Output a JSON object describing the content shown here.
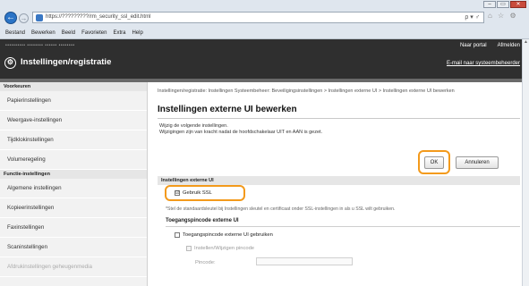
{
  "browser": {
    "window_buttons": [
      "–",
      "▭",
      "✕"
    ],
    "address_url": "https://?????????/rm_security_ssl_edit.html",
    "address_icons": "ρ ▾ ♂",
    "tab_stub": "⌂ ☆ ⚙",
    "menu": [
      "Bestand",
      "Bewerken",
      "Beeld",
      "Favorieten",
      "Extra",
      "Help"
    ]
  },
  "header": {
    "device_info": "••••••••••  ••••••••  ••••••  ••••••••",
    "title": "Instellingen/registratie",
    "links": [
      "Naar portal",
      "Afmelden"
    ],
    "email_link": "E-mail naar systeembeheerder"
  },
  "sidebar": {
    "sections": [
      {
        "title": "Voorkeuren",
        "items": [
          "Papierinstellingen",
          "Weergave-instellingen",
          "Tijdklokinstellingen",
          "Volumeregeling"
        ]
      },
      {
        "title": "Functie-instellingen",
        "items": [
          "Algemene instellingen",
          "Kopieerinstellingen",
          "Faxinstellingen",
          "Scaninstellingen",
          "Afdrukinstellingen geheugenmedia"
        ]
      }
    ]
  },
  "main": {
    "breadcrumb": "Instellingen/registratie: Instellingen Systeembeheer: Beveiligingsinstellingen > Instellingen externe UI > Instellingen externe UI bewerken",
    "title": "Instellingen externe UI bewerken",
    "description_line1": "Wijzig de volgende instellingen.",
    "description_line2": "Wijzigingen zijn van kracht nadat de hoofdschakelaar UIT en AAN is gezet.",
    "ok_label": "OK",
    "cancel_label": "Annuleren",
    "section_title": "Instellingen externe UI",
    "ssl_label": "Gebruik SSL",
    "ssl_checked": "☑",
    "note": "*Stel de standaardsleutel bij Instellingen sleutel en certificaat onder SSL-instellingen in als u SSL wilt gebruiken.",
    "pin_section_title": "Toegangspincode externe UI",
    "use_pin_label": "Toegangspincode externe UI gebruiken",
    "set_pin_label": "Instellen/Wijzigen pincode",
    "pin_field_label": "Pincode:"
  },
  "colors": {
    "header_bg": "#2f2f2f",
    "highlight_ring": "#f39a1c",
    "browser_accent": "#2b74c6"
  }
}
